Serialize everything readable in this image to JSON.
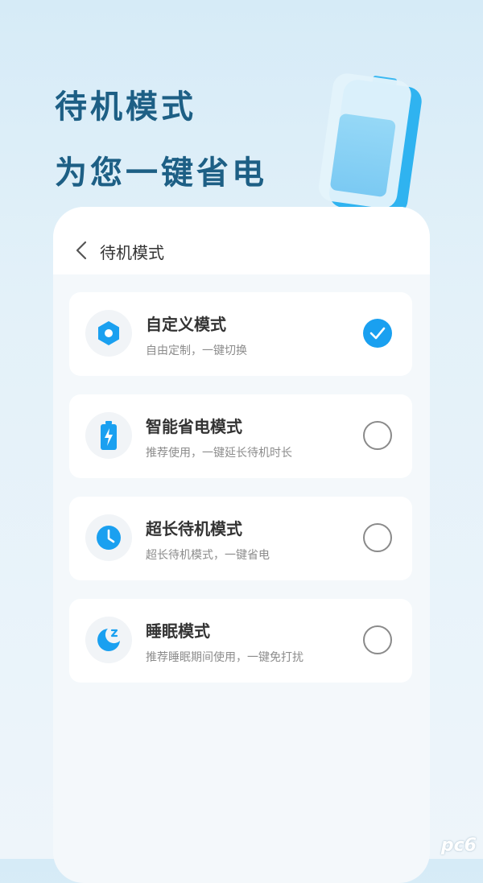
{
  "header": {
    "line1": "待机模式",
    "line2": "为您一键省电"
  },
  "nav": {
    "title": "待机模式"
  },
  "modes": [
    {
      "name": "自定义模式",
      "desc": "自由定制，一键切换",
      "icon": "gear-icon",
      "selected": true
    },
    {
      "name": "智能省电模式",
      "desc": "推荐使用，一键延长待机时长",
      "icon": "battery-bolt-icon",
      "selected": false
    },
    {
      "name": "超长待机模式",
      "desc": "超长待机模式，一键省电",
      "icon": "clock-icon",
      "selected": false
    },
    {
      "name": "睡眠模式",
      "desc": "推荐睡眠期间使用，一键免打扰",
      "icon": "sleep-moon-icon",
      "selected": false
    }
  ],
  "watermark": "pc6",
  "colors": {
    "accent": "#1aa0f0",
    "headline": "#1d5f85"
  }
}
